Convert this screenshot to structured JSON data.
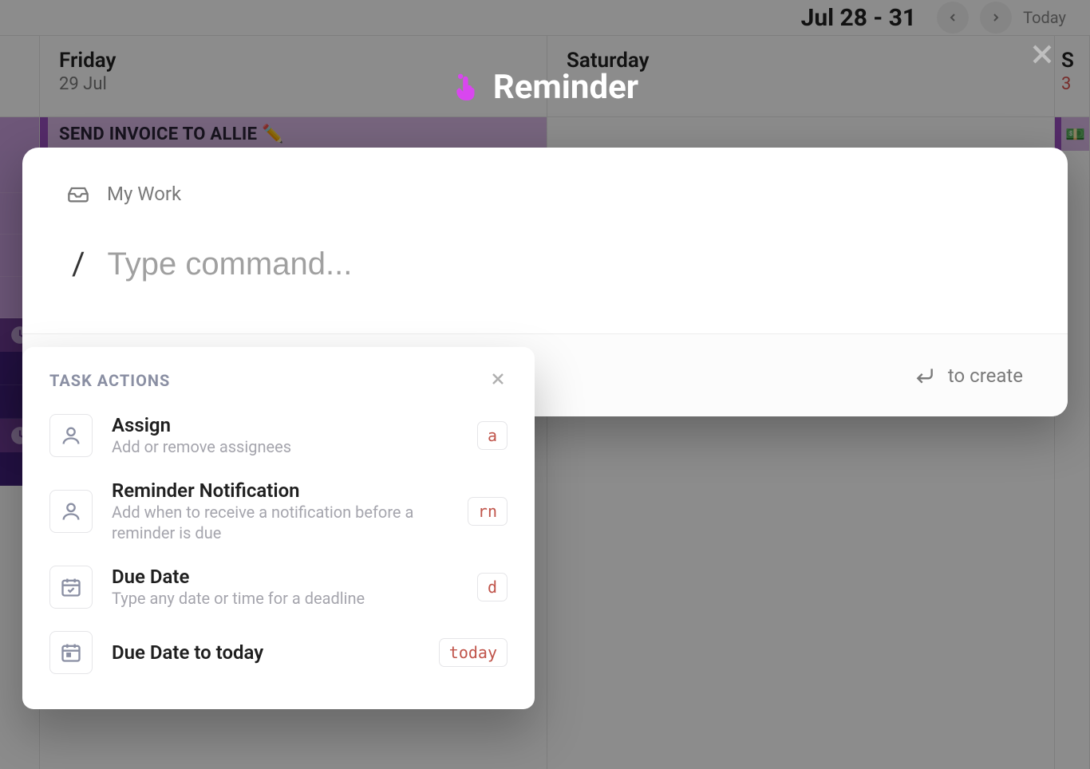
{
  "header": {
    "date_range": "Jul 28 - 31",
    "today_label": "Today"
  },
  "calendar": {
    "friday": {
      "name": "Friday",
      "date": "29 Jul",
      "event": "SEND INVOICE TO ALLIE ✏️"
    },
    "saturday": {
      "name": "Saturday"
    },
    "sunday": {
      "name_initial": "S",
      "date_partial": "3",
      "badge_emoji": "💵"
    }
  },
  "modal": {
    "title": "Reminder",
    "location_label": "My Work",
    "slash": "/",
    "command_placeholder": "Type command...",
    "create_hint": "to create"
  },
  "dropdown": {
    "heading": "TASK ACTIONS",
    "items": [
      {
        "icon": "person",
        "title": "Assign",
        "desc": "Add or remove assignees",
        "shortcut": "a"
      },
      {
        "icon": "person",
        "title": "Reminder Notification",
        "desc": "Add when to receive a notification before a reminder is due",
        "shortcut": "rn"
      },
      {
        "icon": "calendar-check",
        "title": "Due Date",
        "desc": "Type any date or time for a deadline",
        "shortcut": "d"
      },
      {
        "icon": "calendar-date",
        "title": "Due Date to today",
        "desc": "",
        "shortcut": "today"
      }
    ]
  }
}
